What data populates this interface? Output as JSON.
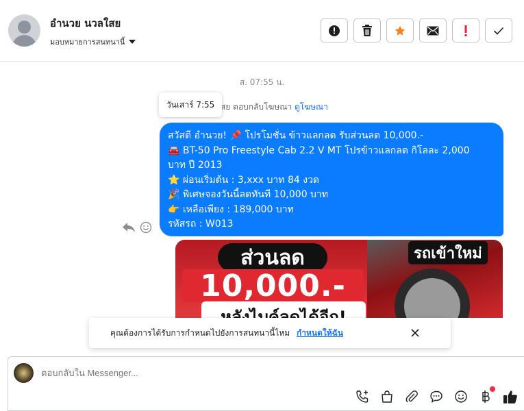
{
  "header": {
    "name": "อำนวย นวลใสย",
    "assign_label": "มอบหมายการสนทนานี้",
    "actions": [
      {
        "name": "spam",
        "icon": "exclamation-circle-icon"
      },
      {
        "name": "delete",
        "icon": "trash-icon"
      },
      {
        "name": "star",
        "icon": "star-icon",
        "color": "#f5821f"
      },
      {
        "name": "mark-unread",
        "icon": "envelope-icon"
      },
      {
        "name": "follow-up",
        "icon": "exclamation-icon",
        "color": "#e41e3f"
      },
      {
        "name": "done",
        "icon": "checkmark-icon"
      }
    ]
  },
  "conversation": {
    "date_stamp": "ส. 07:55 น.",
    "tooltip": "วันเสาร์ 7:55",
    "reply_prefix": "สย ตอบกลับโฆษณา",
    "reply_link": "ดูโฆษณา",
    "message_lines": [
      "สวัสดี อำนวย! 📌 โปรโมชั่น ข้าวแลกลด รับส่วนลด 10,000.-",
      "🚘 BT-50 Pro Freestyle Cab 2.2 V MT โปรข้าวแลกลด กิโลละ 2,000",
      "บาท ปี 2013",
      "⭐ ผ่อนเริ่มต้น : 3,xxx บาท 84 งวด",
      "🎉 พิเศษจองวันนี้ลดทันที 10,000 บาท",
      "👉 เหลือเพียง : 189,000 บาท",
      "รหัสรถ : W013"
    ],
    "bubble_color": "#0a7cff",
    "promo": {
      "pill_text": "ส่วนลด",
      "amount": "10,000.-",
      "bottom_text": "หลังไบค์ลดได้อีก!",
      "badge": "รถเข้าใหม่"
    }
  },
  "notice": {
    "text": "คุณต้องการได้รับการกำหนดไปยังการสนทนานี้ไหม",
    "link": "กำหนดให้ฉัน"
  },
  "composer": {
    "placeholder": "ตอบกลับใน Messenger...",
    "tools": [
      "call-add-icon",
      "shopping-bag-icon",
      "paperclip-icon",
      "saved-reply-icon",
      "emoji-icon",
      "payment-baht-icon",
      "thumbs-up-icon"
    ],
    "accent": "#1c1e21"
  }
}
